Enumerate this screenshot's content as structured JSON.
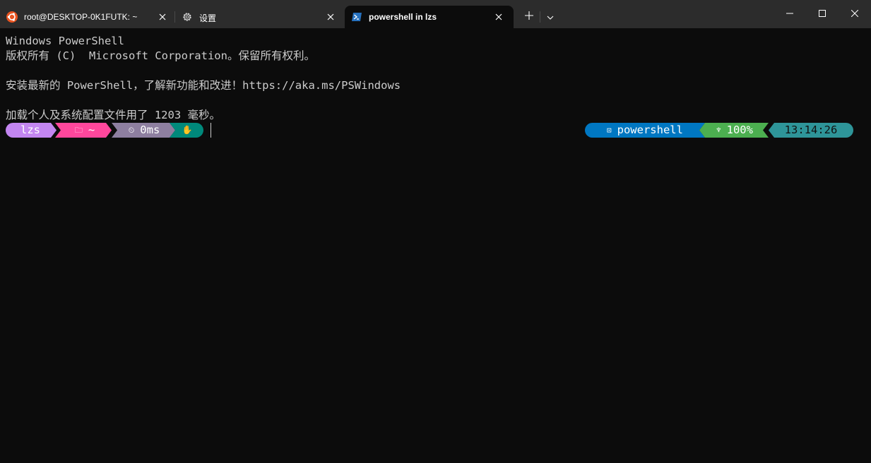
{
  "tabs": [
    {
      "label": "root@DESKTOP-0K1FUTK: ~",
      "icon": "ubuntu-icon"
    },
    {
      "label": "设置",
      "icon": "gear-icon"
    },
    {
      "label": "powershell in lzs",
      "icon": "powershell-icon"
    }
  ],
  "terminal": {
    "lines": [
      "Windows PowerShell",
      "版权所有 (C)  Microsoft Corporation。保留所有权利。",
      "",
      "安装最新的 PowerShell，了解新功能和改进！https://aka.ms/PSWindows",
      "",
      "加载个人及系统配置文件用了 1203 毫秒。"
    ]
  },
  "prompt": {
    "left": {
      "user": "lzs",
      "path": "~",
      "exec_time": "0ms"
    },
    "right": {
      "shell": "powershell",
      "battery": "100%",
      "time": "13:14:26"
    }
  },
  "colors": {
    "user_seg": "#c386f1",
    "path_seg": "#ff479c",
    "time_seg": "#8e7fa0",
    "status_seg": "#00897b",
    "shell_seg": "#0077c2",
    "battery_seg": "#4caf50",
    "clock_seg": "#2e9599"
  }
}
